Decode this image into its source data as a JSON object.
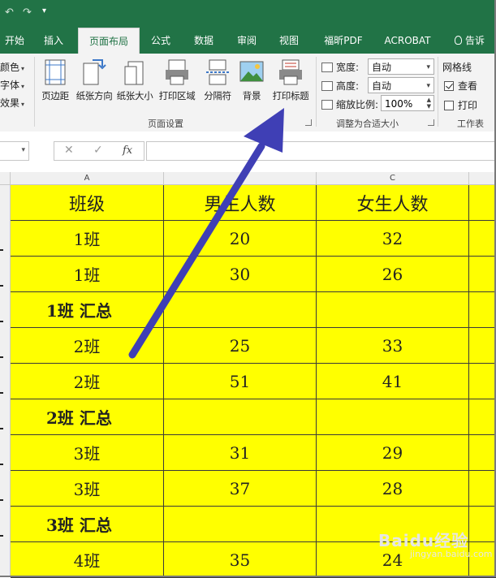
{
  "quick_access": {
    "undo": "↶",
    "redo": "↷",
    "customize": "▾"
  },
  "tabs": [
    {
      "label": "开始"
    },
    {
      "label": "插入"
    },
    {
      "label": "页面布局",
      "active": true
    },
    {
      "label": "公式"
    },
    {
      "label": "数据"
    },
    {
      "label": "审阅"
    },
    {
      "label": "视图"
    },
    {
      "label": "福昕PDF"
    },
    {
      "label": "ACROBAT"
    }
  ],
  "tell_me": "告诉",
  "ribbon": {
    "themes": {
      "colors": "颜色",
      "fonts": "字体",
      "effects": "效果"
    },
    "page_setup": {
      "margins": "页边距",
      "orientation": "纸张方向",
      "size": "纸张大小",
      "print_area": "打印区域",
      "breaks": "分隔符",
      "background": "背景",
      "print_titles": "打印标题",
      "group_label": "页面设置"
    },
    "scale_to_fit": {
      "width_label": "宽度:",
      "width_value": "自动",
      "height_label": "高度:",
      "height_value": "自动",
      "scale_label": "缩放比例:",
      "scale_value": "100%",
      "group_label": "调整为合适大小"
    },
    "sheet_options": {
      "gridlines_title": "网格线",
      "view_label": "查看",
      "view_checked": true,
      "print_label": "打印",
      "print_checked": false,
      "group_label": "工作表"
    }
  },
  "formula_bar": {
    "name_box": "",
    "cancel": "✕",
    "enter": "✓",
    "fx": "fx",
    "content": ""
  },
  "columns": [
    "A",
    "",
    "C"
  ],
  "table": {
    "header": [
      "班级",
      "男生人数",
      "女生人数"
    ],
    "rows": [
      [
        "1班",
        "20",
        "32"
      ],
      [
        "1班",
        "30",
        "26"
      ],
      [
        "1班  汇总",
        "",
        ""
      ],
      [
        "2班",
        "25",
        "33"
      ],
      [
        "2班",
        "51",
        "41"
      ],
      [
        "2班  汇总",
        "",
        ""
      ],
      [
        "3班",
        "31",
        "29"
      ],
      [
        "3班",
        "37",
        "28"
      ],
      [
        "3班  汇总",
        "",
        ""
      ],
      [
        "4班",
        "35",
        "24"
      ]
    ]
  },
  "annotation": {
    "arrow_color": "#3f3fb5"
  },
  "watermark": {
    "main": "Baidu经验",
    "sub": "jingyan.baidu.com"
  },
  "colors": {
    "excel_green": "#217346",
    "cell_fill": "#ffff00"
  }
}
